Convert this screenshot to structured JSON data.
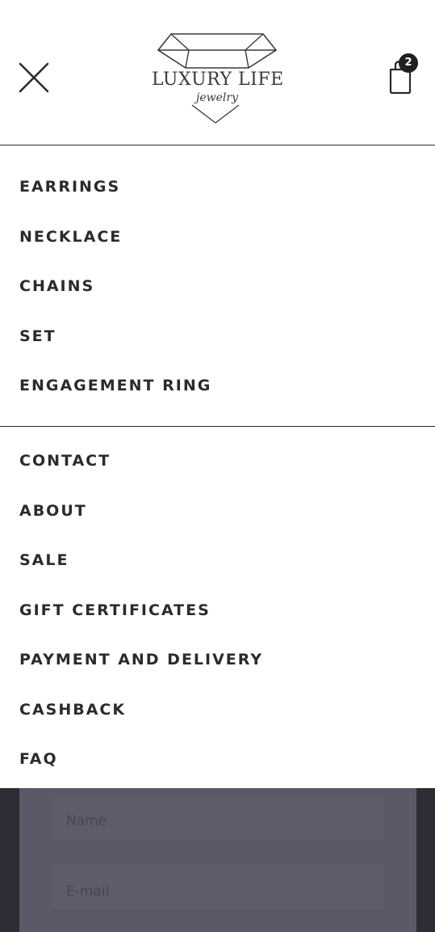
{
  "header": {
    "logo_text": "LUXURY LIFE",
    "logo_subtext": "jewelry",
    "cart_count": "2"
  },
  "menu": {
    "primary": [
      {
        "label": "EARRINGS"
      },
      {
        "label": "NECKLACE"
      },
      {
        "label": "CHAINS"
      },
      {
        "label": "SET"
      },
      {
        "label": "ENGAGEMENT RING"
      }
    ],
    "secondary": [
      {
        "label": "CONTACT"
      },
      {
        "label": "ABOUT"
      },
      {
        "label": "SALE"
      },
      {
        "label": "GIFT CERTIFICATES"
      },
      {
        "label": "PAYMENT AND DELIVERY"
      },
      {
        "label": "CASHBACK"
      },
      {
        "label": "FAQ"
      }
    ]
  },
  "background_form": {
    "name_placeholder": "Name",
    "email_placeholder": "E-mail"
  },
  "icons": {
    "close": "close-icon",
    "cart": "shopping-bag-icon",
    "logo": "diamond-icon"
  },
  "colors": {
    "text": "#2b2b2b",
    "badge": "#1f1f24",
    "overlay_dark": "#2e2d35",
    "overlay_panel": "#5a5967"
  }
}
